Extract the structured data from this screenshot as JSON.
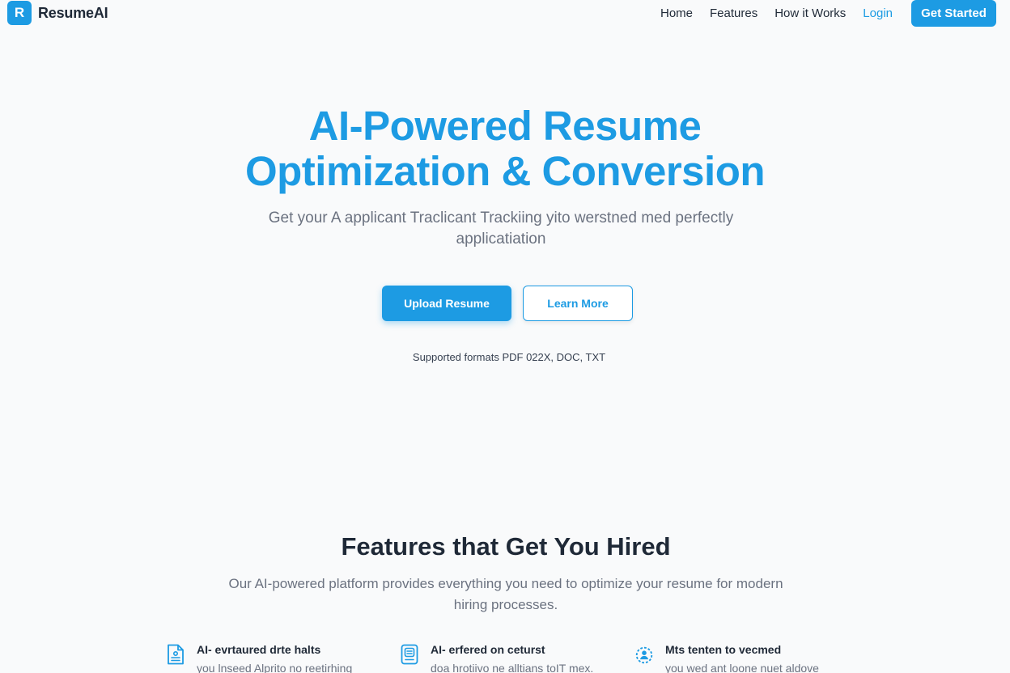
{
  "brand": {
    "mark": "R",
    "name": "ResumeAI"
  },
  "nav": {
    "links": [
      "Home",
      "Features",
      "How it Works"
    ],
    "login": "Login",
    "cta": "Get Started"
  },
  "hero": {
    "title_line1": "AI-Powered Resume",
    "title_line2": "Optimization & Conversion",
    "subtitle": "Get your A applicant Traclicant Trackiing yito werstned med perfectly applicatiation",
    "primary_button": "Upload Resume",
    "secondary_button": "Learn More",
    "formats": "Supported formats PDF 022X, DOC, TXT"
  },
  "features": {
    "title": "Features that Get You Hired",
    "subtitle": "Our AI-powered platform provides everything you need to optimize your resume for modern hiring processes.",
    "items": [
      {
        "icon": "document-icon",
        "title": "AI- evrtaured drte halts",
        "desc": "you lnseed Alprito no reetirhing"
      },
      {
        "icon": "file-edit-icon",
        "title": "AI- erfered on ceturst",
        "desc": "doa hrotiivo ne alltians toIT mex."
      },
      {
        "icon": "user-settings-icon",
        "title": "Mts tenten to vecmed",
        "desc": "you wed ant loone nuet aldove"
      }
    ]
  },
  "colors": {
    "accent": "#1d9be3",
    "text": "#1f2937",
    "muted": "#6b7280",
    "background": "#f9fafb"
  }
}
